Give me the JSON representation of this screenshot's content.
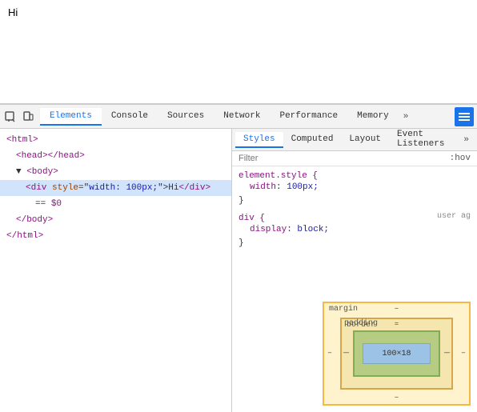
{
  "page": {
    "content": "Hi"
  },
  "devtools": {
    "tabs": [
      {
        "label": "Elements",
        "active": true
      },
      {
        "label": "Console",
        "active": false
      },
      {
        "label": "Sources",
        "active": false
      },
      {
        "label": "Network",
        "active": false
      },
      {
        "label": "Performance",
        "active": false
      },
      {
        "label": "Memory",
        "active": false
      }
    ],
    "overflow_tab": "»",
    "menu_icon": "≡"
  },
  "dom": {
    "lines": [
      {
        "text_html": "<html>",
        "indent": 0
      },
      {
        "text_html": "<head></head>",
        "indent": 1
      },
      {
        "text_html": "▼ <body>",
        "indent": 1
      },
      {
        "text_html": "<div style=\"width: 100px;\">Hi</div>",
        "indent": 2,
        "selected": true
      },
      {
        "text_html": "== $0",
        "indent": 3
      },
      {
        "text_html": "</body>",
        "indent": 1
      },
      {
        "text_html": "</html>",
        "indent": 0
      }
    ]
  },
  "styles": {
    "sub_tabs": [
      {
        "label": "Styles",
        "active": true
      },
      {
        "label": "Computed",
        "active": false
      },
      {
        "label": "Layout",
        "active": false
      },
      {
        "label": "Event Listeners",
        "active": false
      }
    ],
    "sub_overflow": "»",
    "filter_placeholder": "Filter",
    "filter_suffix": ":hov",
    "rules": [
      {
        "selector": "element.style {",
        "source": "",
        "properties": [
          {
            "name": "width",
            "colon": ":",
            "value": " 100px;"
          }
        ],
        "close": "}"
      },
      {
        "selector": "div {",
        "source": "user ag",
        "properties": [
          {
            "name": "display",
            "colon": ":",
            "value": " block;"
          }
        ],
        "close": "}"
      }
    ]
  },
  "box_model": {
    "margin_label": "margin",
    "margin_dash": "–",
    "border_label": "border",
    "border_dash": "–",
    "padding_label": "padding",
    "padding_dash": "–",
    "content_size": "100×18",
    "content_dash_top": "–",
    "content_dash_bottom": "–"
  }
}
